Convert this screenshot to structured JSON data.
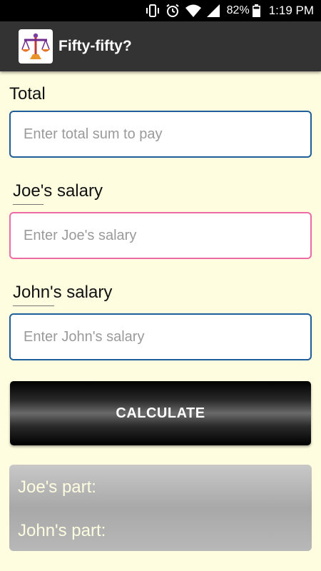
{
  "status_bar": {
    "battery": "82%",
    "time": "1:19 PM",
    "icons": [
      "vibrate-icon",
      "alarm-icon",
      "wifi-icon",
      "signal-icon",
      "battery-icon"
    ]
  },
  "app_bar": {
    "title": "Fifty-fifty?",
    "icon": "balance-scale-icon"
  },
  "form": {
    "total": {
      "label": "Total",
      "placeholder": "Enter total sum to pay"
    },
    "joe": {
      "name": "Joe",
      "label_suffix": "'s salary",
      "placeholder": "Enter Joe's salary"
    },
    "john": {
      "name": "John",
      "label_suffix": "'s salary",
      "placeholder": "Enter John's salary"
    },
    "calculate_label": "CALCULATE"
  },
  "result": {
    "joe_part": "Joe's part:",
    "john_part": "John's part:"
  },
  "colors": {
    "background": "#fefde0",
    "app_bar": "#333333",
    "field_border": "#1f5f99",
    "field_border_focused": "#ee6aa7"
  }
}
